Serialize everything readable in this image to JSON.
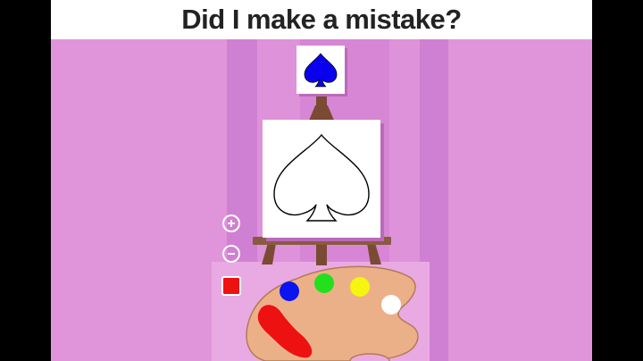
{
  "title": "Did I make a mistake?",
  "colors": {
    "background": "#e095db",
    "target_spade": "#0a00f0",
    "selected": "#ee1111",
    "palette_wood": "#ecb088"
  },
  "target": {
    "icon": "spade-icon",
    "fill": "#0a00f0"
  },
  "canvas": {
    "shape": "spade-outline-icon",
    "fill": "#ffffff"
  },
  "controls": {
    "zoom_in": "plus-icon",
    "zoom_out": "minus-icon",
    "selected_color": "#ee1111"
  },
  "palette": {
    "paints": [
      {
        "name": "blue",
        "color": "#0a14f0"
      },
      {
        "name": "green",
        "color": "#22e01c"
      },
      {
        "name": "yellow",
        "color": "#f6f510"
      },
      {
        "name": "white",
        "color": "#ffffff"
      },
      {
        "name": "red",
        "color": "#ee1111"
      }
    ]
  }
}
